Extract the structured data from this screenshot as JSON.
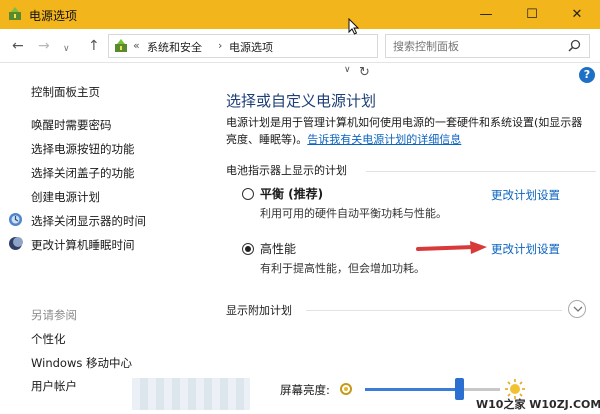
{
  "window": {
    "title": "电源选项",
    "controls": {
      "minimize": "—",
      "maximize": "☐",
      "close": "✕"
    }
  },
  "address": {
    "back": "←",
    "forward": "→",
    "history": "∨",
    "up": "↑",
    "breadcrumb_prefix": "«",
    "breadcrumbs": [
      "系统和安全",
      "电源选项"
    ],
    "separator": "›",
    "dropdown": "∨",
    "refresh": "↻",
    "search_placeholder": "搜索控制面板"
  },
  "help": {
    "label": "?"
  },
  "sidebar": {
    "home": "控制面板主页",
    "links": [
      {
        "label": "唤醒时需要密码"
      },
      {
        "label": "选择电源按钮的功能"
      },
      {
        "label": "选择关闭盖子的功能"
      },
      {
        "label": "创建电源计划"
      },
      {
        "label": "选择关闭显示器的时间",
        "icon": "monitor-icon"
      },
      {
        "label": "更改计算机睡眠时间",
        "icon": "moon-icon"
      }
    ],
    "see_also_heading": "另请参阅",
    "see_also": [
      {
        "label": "个性化"
      },
      {
        "label": "Windows 移动中心"
      },
      {
        "label": "用户帐户"
      }
    ]
  },
  "main": {
    "title": "选择或自定义电源计划",
    "description": "电源计划是用于管理计算机如何使用电源的一套硬件和系统设置(如显示器亮度、睡眠等)。",
    "description_link": "告诉我有关电源计划的详细信息",
    "section_label": "电池指示器上显示的计划",
    "plans": [
      {
        "name": "平衡 (推荐)",
        "description": "利用可用的硬件自动平衡功耗与性能。",
        "link": "更改计划设置",
        "selected": false
      },
      {
        "name": "高性能",
        "description": "有利于提高性能，但会增加功耗。",
        "link": "更改计划设置",
        "selected": true
      }
    ],
    "show_more": "显示附加计划"
  },
  "footer": {
    "brightness_label": "屏幕亮度:",
    "brightness_value": 0.7
  },
  "watermark": "W10之家 W10ZJ.COM",
  "colors": {
    "titlebar": "#f3b51c",
    "title_text": "#1e3f78",
    "link": "#0b64c0",
    "arrow": "#d83a3a",
    "slider": "#2b6fd0"
  }
}
